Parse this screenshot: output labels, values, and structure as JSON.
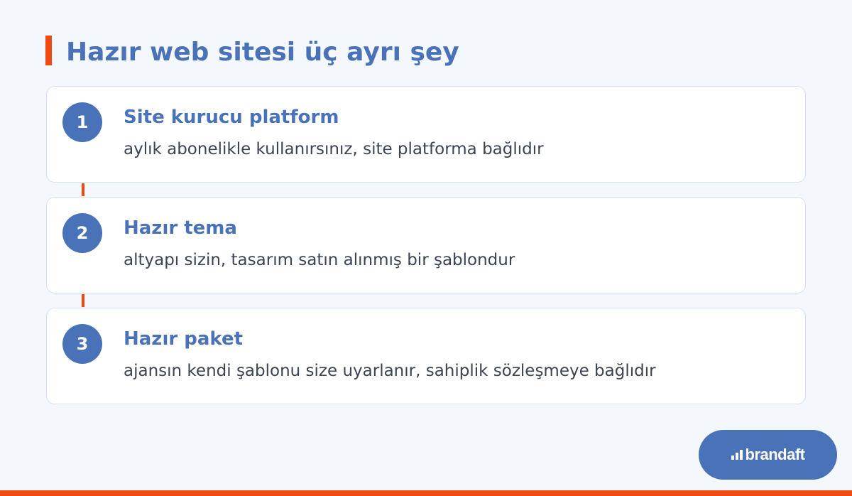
{
  "header": {
    "title": "Hazır web sitesi üç ayrı şey"
  },
  "items": [
    {
      "number": "1",
      "title": "Site kurucu platform",
      "description": "aylık abonelikle kullanırsınız, site platforma bağlıdır"
    },
    {
      "number": "2",
      "title": "Hazır tema",
      "description": "altyapı sizin, tasarım satın alınmış bir şablondur"
    },
    {
      "number": "3",
      "title": "Hazır paket",
      "description": "ajansın kendi şablonu size uyarlanır, sahiplik sözleşmeye bağlıdır"
    }
  ],
  "brand": {
    "logo_text": "brandaft"
  },
  "colors": {
    "accent": "#f04a12",
    "primary": "#4a72b8",
    "background": "#f4f7fc",
    "card": "#ffffff",
    "body_text": "#3c4452"
  }
}
